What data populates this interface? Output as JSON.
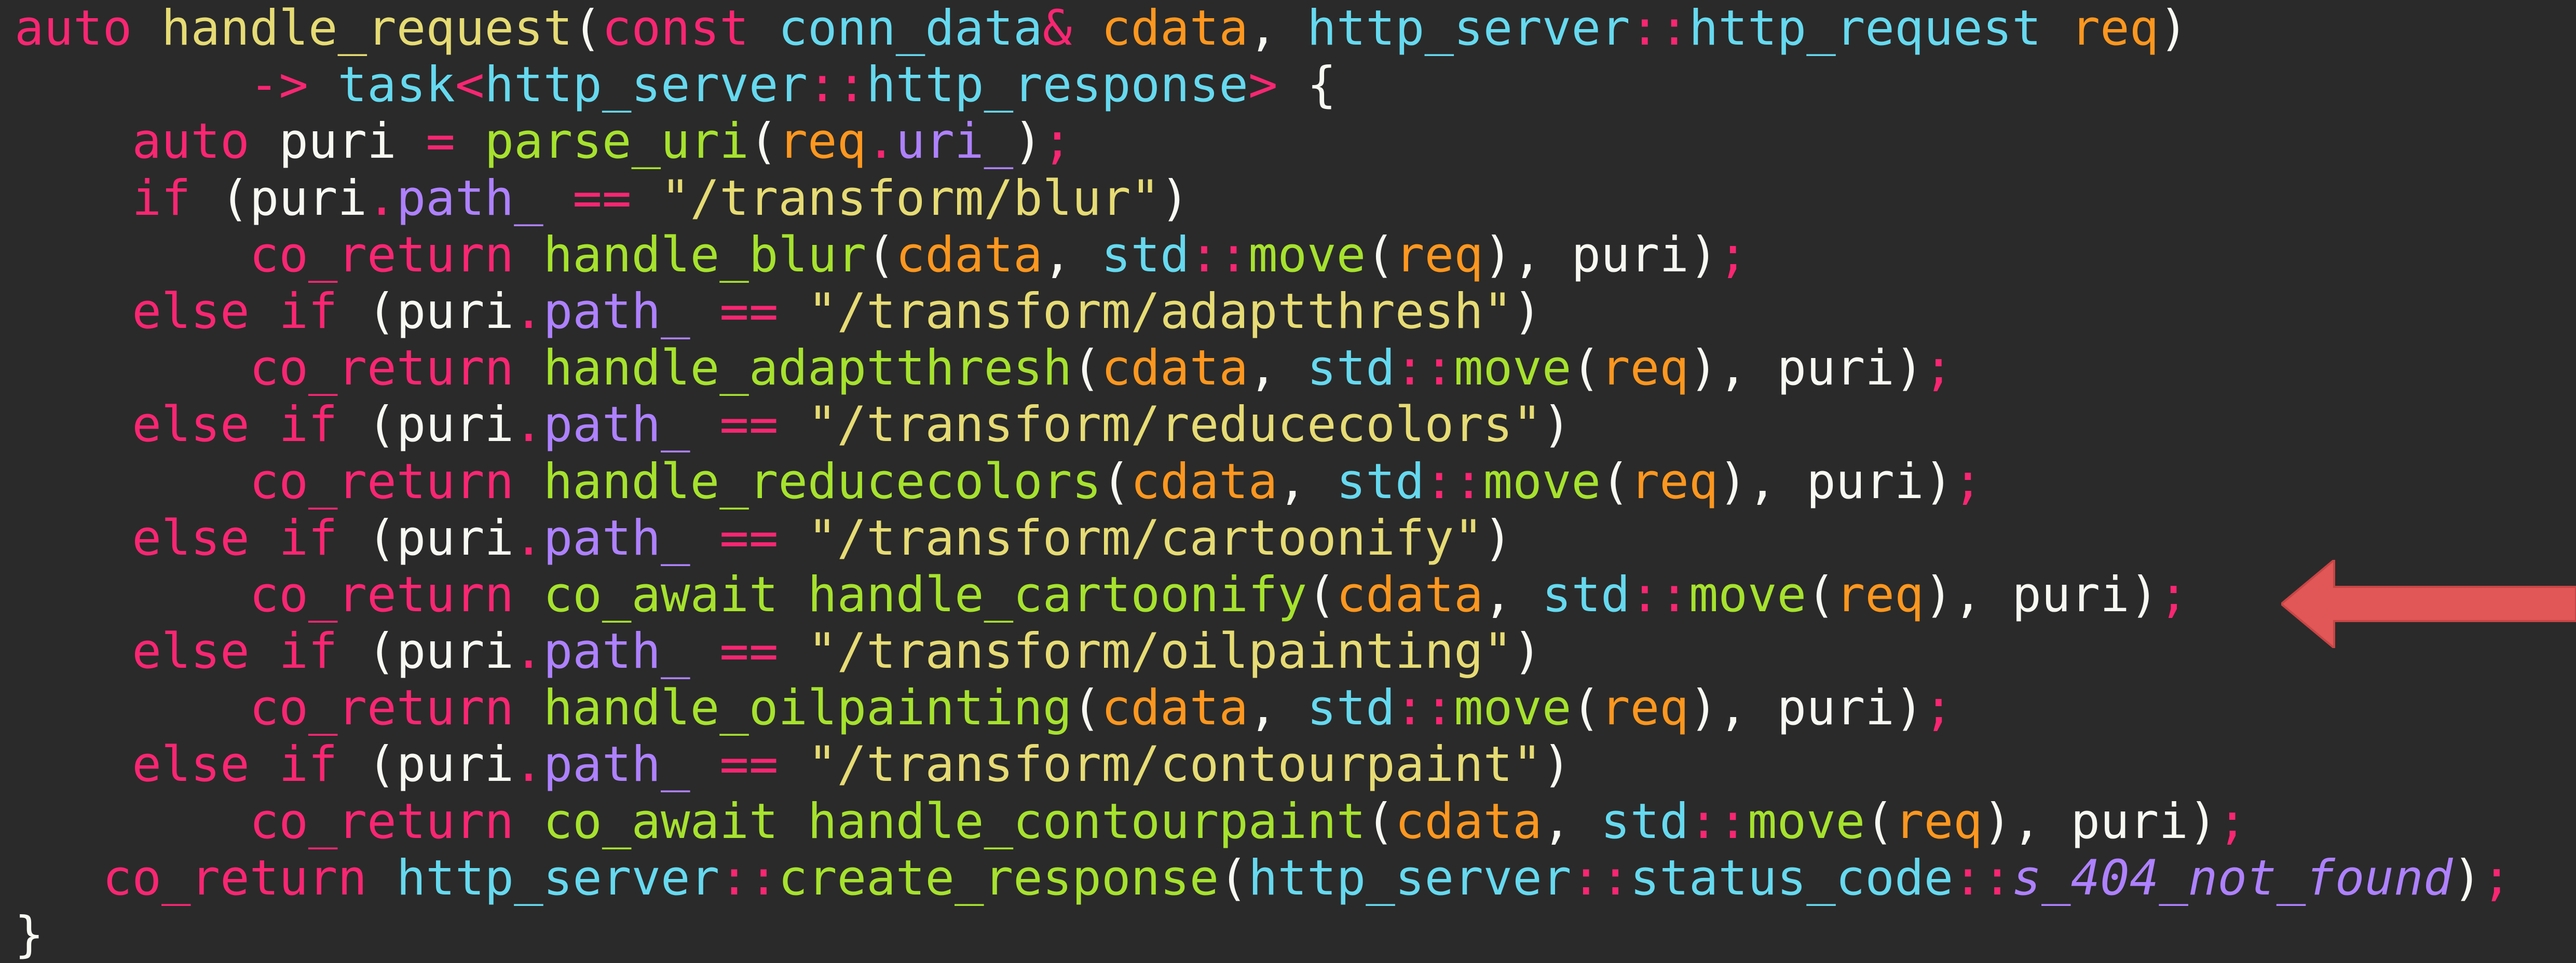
{
  "editor": {
    "colors": {
      "background": "#2a2a2a",
      "keyword": "#f92672",
      "type": "#66d9ef",
      "function": "#a6e22e",
      "string": "#e6db74",
      "param": "#fd971f",
      "member": "#ae81ff",
      "plain": "#f8f8f2"
    },
    "lines": [
      [
        {
          "t": "auto",
          "c": "kw"
        },
        {
          "t": " ",
          "c": "var"
        },
        {
          "t": "handle_request",
          "c": "str"
        },
        {
          "t": "(",
          "c": "var"
        },
        {
          "t": "const",
          "c": "kw"
        },
        {
          "t": " ",
          "c": "var"
        },
        {
          "t": "conn_data",
          "c": "ty"
        },
        {
          "t": "&",
          "c": "kw"
        },
        {
          "t": " cdata",
          "c": "pa"
        },
        {
          "t": ", ",
          "c": "var"
        },
        {
          "t": "http_server",
          "c": "ty"
        },
        {
          "t": "::",
          "c": "kw"
        },
        {
          "t": "http_request",
          "c": "ty"
        },
        {
          "t": " req",
          "c": "pa"
        },
        {
          "t": ")",
          "c": "var"
        }
      ],
      [
        {
          "t": "        ",
          "c": "var"
        },
        {
          "t": "->",
          "c": "kw"
        },
        {
          "t": " task",
          "c": "ty"
        },
        {
          "t": "<",
          "c": "kw"
        },
        {
          "t": "http_server",
          "c": "ty"
        },
        {
          "t": "::",
          "c": "kw"
        },
        {
          "t": "http_response",
          "c": "ty"
        },
        {
          "t": ">",
          "c": "kw"
        },
        {
          "t": " {",
          "c": "var"
        }
      ],
      [
        {
          "t": "    ",
          "c": "var"
        },
        {
          "t": "auto",
          "c": "kw"
        },
        {
          "t": " puri ",
          "c": "var"
        },
        {
          "t": "=",
          "c": "kw"
        },
        {
          "t": " ",
          "c": "var"
        },
        {
          "t": "parse_uri",
          "c": "fn"
        },
        {
          "t": "(",
          "c": "var"
        },
        {
          "t": "req",
          "c": "pa"
        },
        {
          "t": ".",
          "c": "kw"
        },
        {
          "t": "uri_",
          "c": "mem"
        },
        {
          "t": ")",
          "c": "var"
        },
        {
          "t": ";",
          "c": "kw"
        }
      ],
      [
        {
          "t": "    ",
          "c": "var"
        },
        {
          "t": "if",
          "c": "kw"
        },
        {
          "t": " (puri",
          "c": "var"
        },
        {
          "t": ".",
          "c": "kw"
        },
        {
          "t": "path_",
          "c": "mem"
        },
        {
          "t": " ",
          "c": "var"
        },
        {
          "t": "==",
          "c": "kw"
        },
        {
          "t": " ",
          "c": "var"
        },
        {
          "t": "\"/transform/blur\"",
          "c": "str"
        },
        {
          "t": ")",
          "c": "var"
        }
      ],
      [
        {
          "t": "        ",
          "c": "var"
        },
        {
          "t": "co_return",
          "c": "kw"
        },
        {
          "t": " ",
          "c": "var"
        },
        {
          "t": "handle_blur",
          "c": "fn"
        },
        {
          "t": "(",
          "c": "var"
        },
        {
          "t": "cdata",
          "c": "pa"
        },
        {
          "t": ", ",
          "c": "var"
        },
        {
          "t": "std",
          "c": "ty"
        },
        {
          "t": "::",
          "c": "kw"
        },
        {
          "t": "move",
          "c": "fn"
        },
        {
          "t": "(",
          "c": "var"
        },
        {
          "t": "req",
          "c": "pa"
        },
        {
          "t": "), puri)",
          "c": "var"
        },
        {
          "t": ";",
          "c": "kw"
        }
      ],
      [
        {
          "t": "    ",
          "c": "var"
        },
        {
          "t": "else",
          "c": "kw"
        },
        {
          "t": " ",
          "c": "var"
        },
        {
          "t": "if",
          "c": "kw"
        },
        {
          "t": " (puri",
          "c": "var"
        },
        {
          "t": ".",
          "c": "kw"
        },
        {
          "t": "path_",
          "c": "mem"
        },
        {
          "t": " ",
          "c": "var"
        },
        {
          "t": "==",
          "c": "kw"
        },
        {
          "t": " ",
          "c": "var"
        },
        {
          "t": "\"/transform/adaptthresh\"",
          "c": "str"
        },
        {
          "t": ")",
          "c": "var"
        }
      ],
      [
        {
          "t": "        ",
          "c": "var"
        },
        {
          "t": "co_return",
          "c": "kw"
        },
        {
          "t": " ",
          "c": "var"
        },
        {
          "t": "handle_adaptthresh",
          "c": "fn"
        },
        {
          "t": "(",
          "c": "var"
        },
        {
          "t": "cdata",
          "c": "pa"
        },
        {
          "t": ", ",
          "c": "var"
        },
        {
          "t": "std",
          "c": "ty"
        },
        {
          "t": "::",
          "c": "kw"
        },
        {
          "t": "move",
          "c": "fn"
        },
        {
          "t": "(",
          "c": "var"
        },
        {
          "t": "req",
          "c": "pa"
        },
        {
          "t": "), puri)",
          "c": "var"
        },
        {
          "t": ";",
          "c": "kw"
        }
      ],
      [
        {
          "t": "    ",
          "c": "var"
        },
        {
          "t": "else",
          "c": "kw"
        },
        {
          "t": " ",
          "c": "var"
        },
        {
          "t": "if",
          "c": "kw"
        },
        {
          "t": " (puri",
          "c": "var"
        },
        {
          "t": ".",
          "c": "kw"
        },
        {
          "t": "path_",
          "c": "mem"
        },
        {
          "t": " ",
          "c": "var"
        },
        {
          "t": "==",
          "c": "kw"
        },
        {
          "t": " ",
          "c": "var"
        },
        {
          "t": "\"/transform/reducecolors\"",
          "c": "str"
        },
        {
          "t": ")",
          "c": "var"
        }
      ],
      [
        {
          "t": "        ",
          "c": "var"
        },
        {
          "t": "co_return",
          "c": "kw"
        },
        {
          "t": " ",
          "c": "var"
        },
        {
          "t": "handle_reducecolors",
          "c": "fn"
        },
        {
          "t": "(",
          "c": "var"
        },
        {
          "t": "cdata",
          "c": "pa"
        },
        {
          "t": ", ",
          "c": "var"
        },
        {
          "t": "std",
          "c": "ty"
        },
        {
          "t": "::",
          "c": "kw"
        },
        {
          "t": "move",
          "c": "fn"
        },
        {
          "t": "(",
          "c": "var"
        },
        {
          "t": "req",
          "c": "pa"
        },
        {
          "t": "), puri)",
          "c": "var"
        },
        {
          "t": ";",
          "c": "kw"
        }
      ],
      [
        {
          "t": "    ",
          "c": "var"
        },
        {
          "t": "else",
          "c": "kw"
        },
        {
          "t": " ",
          "c": "var"
        },
        {
          "t": "if",
          "c": "kw"
        },
        {
          "t": " (puri",
          "c": "var"
        },
        {
          "t": ".",
          "c": "kw"
        },
        {
          "t": "path_",
          "c": "mem"
        },
        {
          "t": " ",
          "c": "var"
        },
        {
          "t": "==",
          "c": "kw"
        },
        {
          "t": " ",
          "c": "var"
        },
        {
          "t": "\"/transform/cartoonify\"",
          "c": "str"
        },
        {
          "t": ")",
          "c": "var"
        }
      ],
      [
        {
          "t": "        ",
          "c": "var"
        },
        {
          "t": "co_return",
          "c": "kw"
        },
        {
          "t": " ",
          "c": "var"
        },
        {
          "t": "co_await",
          "c": "fn"
        },
        {
          "t": " ",
          "c": "var"
        },
        {
          "t": "handle_cartoonify",
          "c": "fn"
        },
        {
          "t": "(",
          "c": "var"
        },
        {
          "t": "cdata",
          "c": "pa"
        },
        {
          "t": ", ",
          "c": "var"
        },
        {
          "t": "std",
          "c": "ty"
        },
        {
          "t": "::",
          "c": "kw"
        },
        {
          "t": "move",
          "c": "fn"
        },
        {
          "t": "(",
          "c": "var"
        },
        {
          "t": "req",
          "c": "pa"
        },
        {
          "t": "), puri)",
          "c": "var"
        },
        {
          "t": ";",
          "c": "kw"
        }
      ],
      [
        {
          "t": "    ",
          "c": "var"
        },
        {
          "t": "else",
          "c": "kw"
        },
        {
          "t": " ",
          "c": "var"
        },
        {
          "t": "if",
          "c": "kw"
        },
        {
          "t": " (puri",
          "c": "var"
        },
        {
          "t": ".",
          "c": "kw"
        },
        {
          "t": "path_",
          "c": "mem"
        },
        {
          "t": " ",
          "c": "var"
        },
        {
          "t": "==",
          "c": "kw"
        },
        {
          "t": " ",
          "c": "var"
        },
        {
          "t": "\"/transform/oilpainting\"",
          "c": "str"
        },
        {
          "t": ")",
          "c": "var"
        }
      ],
      [
        {
          "t": "        ",
          "c": "var"
        },
        {
          "t": "co_return",
          "c": "kw"
        },
        {
          "t": " ",
          "c": "var"
        },
        {
          "t": "handle_oilpainting",
          "c": "fn"
        },
        {
          "t": "(",
          "c": "var"
        },
        {
          "t": "cdata",
          "c": "pa"
        },
        {
          "t": ", ",
          "c": "var"
        },
        {
          "t": "std",
          "c": "ty"
        },
        {
          "t": "::",
          "c": "kw"
        },
        {
          "t": "move",
          "c": "fn"
        },
        {
          "t": "(",
          "c": "var"
        },
        {
          "t": "req",
          "c": "pa"
        },
        {
          "t": "), puri)",
          "c": "var"
        },
        {
          "t": ";",
          "c": "kw"
        }
      ],
      [
        {
          "t": "    ",
          "c": "var"
        },
        {
          "t": "else",
          "c": "kw"
        },
        {
          "t": " ",
          "c": "var"
        },
        {
          "t": "if",
          "c": "kw"
        },
        {
          "t": " (puri",
          "c": "var"
        },
        {
          "t": ".",
          "c": "kw"
        },
        {
          "t": "path_",
          "c": "mem"
        },
        {
          "t": " ",
          "c": "var"
        },
        {
          "t": "==",
          "c": "kw"
        },
        {
          "t": " ",
          "c": "var"
        },
        {
          "t": "\"/transform/contourpaint\"",
          "c": "str"
        },
        {
          "t": ")",
          "c": "var"
        }
      ],
      [
        {
          "t": "        ",
          "c": "var"
        },
        {
          "t": "co_return",
          "c": "kw"
        },
        {
          "t": " ",
          "c": "var"
        },
        {
          "t": "co_await",
          "c": "fn"
        },
        {
          "t": " ",
          "c": "var"
        },
        {
          "t": "handle_contourpaint",
          "c": "fn"
        },
        {
          "t": "(",
          "c": "var"
        },
        {
          "t": "cdata",
          "c": "pa"
        },
        {
          "t": ", ",
          "c": "var"
        },
        {
          "t": "std",
          "c": "ty"
        },
        {
          "t": "::",
          "c": "kw"
        },
        {
          "t": "move",
          "c": "fn"
        },
        {
          "t": "(",
          "c": "var"
        },
        {
          "t": "req",
          "c": "pa"
        },
        {
          "t": "), puri)",
          "c": "var"
        },
        {
          "t": ";",
          "c": "kw"
        }
      ],
      [
        {
          "t": "   ",
          "c": "var"
        },
        {
          "t": "co_return",
          "c": "kw"
        },
        {
          "t": " ",
          "c": "var"
        },
        {
          "t": "http_server",
          "c": "ty"
        },
        {
          "t": "::",
          "c": "kw"
        },
        {
          "t": "create_response",
          "c": "fn"
        },
        {
          "t": "(",
          "c": "var"
        },
        {
          "t": "http_server",
          "c": "ty"
        },
        {
          "t": "::",
          "c": "kw"
        },
        {
          "t": "status_code",
          "c": "ty"
        },
        {
          "t": "::",
          "c": "kw"
        },
        {
          "t": "s_404_not_found",
          "c": "it"
        },
        {
          "t": ")",
          "c": "var"
        },
        {
          "t": ";",
          "c": "kw"
        }
      ],
      [
        {
          "t": "}",
          "c": "var"
        }
      ]
    ],
    "highlighted_line": 11,
    "arrow": {
      "icon": "left-arrow-icon",
      "color": "#e15656",
      "points_to_line": 11
    }
  }
}
